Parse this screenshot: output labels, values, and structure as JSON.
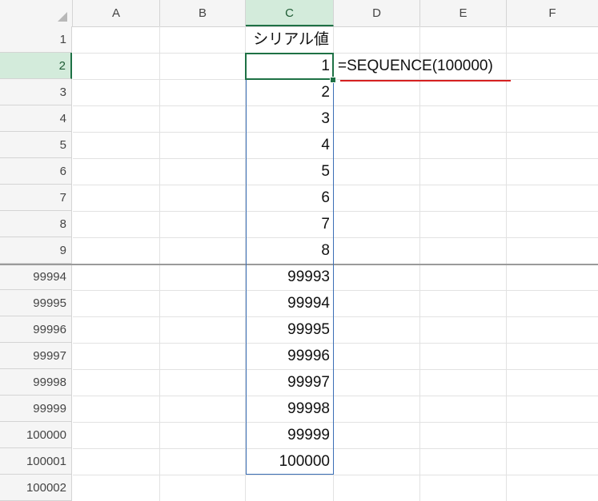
{
  "columns": [
    "A",
    "B",
    "C",
    "D",
    "E",
    "F"
  ],
  "rows": [
    "1",
    "2",
    "3",
    "4",
    "5",
    "6",
    "7",
    "8",
    "9",
    "99994",
    "99995",
    "99996",
    "99997",
    "99998",
    "99999",
    "100000",
    "100001",
    "100002"
  ],
  "cells": {
    "c1": "シリアル値",
    "d2": "=SEQUENCE(100000)",
    "c_values": [
      "1",
      "2",
      "3",
      "4",
      "5",
      "6",
      "7",
      "8",
      "99993",
      "99994",
      "99995",
      "99996",
      "99997",
      "99998",
      "99999",
      "100000"
    ]
  },
  "colors": {
    "selection": "#1e7145",
    "spill_border": "#3b6fb6",
    "annotation_underline": "#d62020"
  }
}
